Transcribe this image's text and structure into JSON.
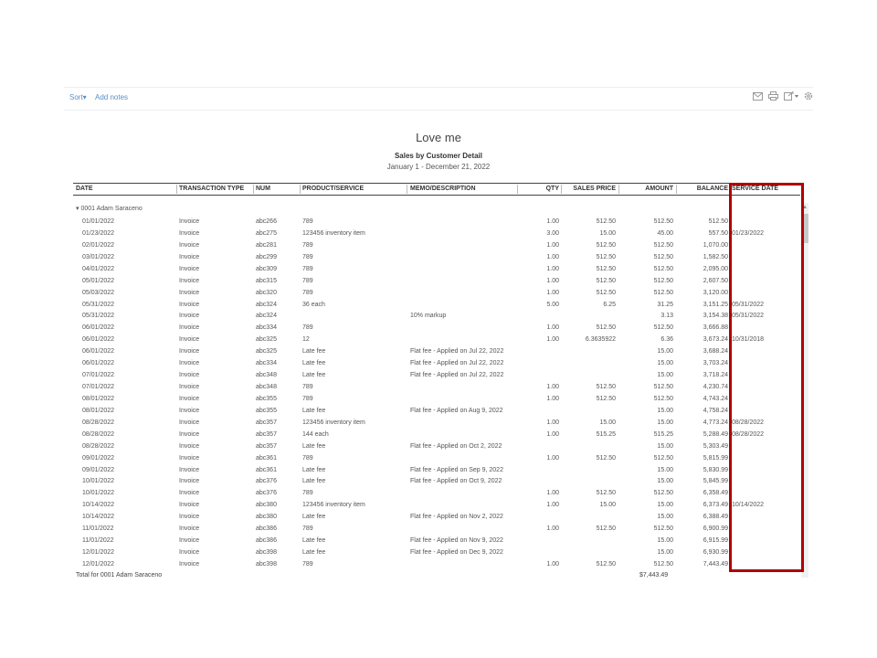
{
  "toolbar": {
    "sort_label": "Sort",
    "sort_caret": "▾",
    "add_notes_label": "Add notes",
    "icons": [
      "email-icon",
      "print-icon",
      "export-icon",
      "settings-icon"
    ]
  },
  "report": {
    "company": "Love me",
    "title": "Sales by Customer Detail",
    "date_range": "January 1 - December 21, 2022"
  },
  "columns": {
    "date": "DATE",
    "type": "TRANSACTION TYPE",
    "num": "NUM",
    "product": "PRODUCT/SERVICE",
    "memo": "MEMO/DESCRIPTION",
    "qty": "QTY",
    "price": "SALES PRICE",
    "amount": "AMOUNT",
    "balance": "BALANCE",
    "service_date": "SERVICE DATE"
  },
  "group": {
    "name": "0001 Adam Saraceno",
    "caret": "▾",
    "total_label": "Total for 0001 Adam Saraceno",
    "total_amount": "$7,443.49"
  },
  "rows": [
    {
      "date": "01/01/2022",
      "type": "Invoice",
      "num": "abc266",
      "product": "789",
      "memo": "",
      "qty": "1.00",
      "price": "512.50",
      "amount": "512.50",
      "balance": "512.50",
      "service_date": ""
    },
    {
      "date": "01/23/2022",
      "type": "Invoice",
      "num": "abc275",
      "product": "123456 inventory item",
      "memo": "",
      "qty": "3.00",
      "price": "15.00",
      "amount": "45.00",
      "balance": "557.50",
      "service_date": "01/23/2022"
    },
    {
      "date": "02/01/2022",
      "type": "Invoice",
      "num": "abc281",
      "product": "789",
      "memo": "",
      "qty": "1.00",
      "price": "512.50",
      "amount": "512.50",
      "balance": "1,070.00",
      "service_date": ""
    },
    {
      "date": "03/01/2022",
      "type": "Invoice",
      "num": "abc299",
      "product": "789",
      "memo": "",
      "qty": "1.00",
      "price": "512.50",
      "amount": "512.50",
      "balance": "1,582.50",
      "service_date": ""
    },
    {
      "date": "04/01/2022",
      "type": "Invoice",
      "num": "abc309",
      "product": "789",
      "memo": "",
      "qty": "1.00",
      "price": "512.50",
      "amount": "512.50",
      "balance": "2,095.00",
      "service_date": ""
    },
    {
      "date": "05/01/2022",
      "type": "Invoice",
      "num": "abc315",
      "product": "789",
      "memo": "",
      "qty": "1.00",
      "price": "512.50",
      "amount": "512.50",
      "balance": "2,607.50",
      "service_date": ""
    },
    {
      "date": "05/03/2022",
      "type": "Invoice",
      "num": "abc320",
      "product": "789",
      "memo": "",
      "qty": "1.00",
      "price": "512.50",
      "amount": "512.50",
      "balance": "3,120.00",
      "service_date": ""
    },
    {
      "date": "05/31/2022",
      "type": "Invoice",
      "num": "abc324",
      "product": "36 each",
      "memo": "",
      "qty": "5.00",
      "price": "6.25",
      "amount": "31.25",
      "balance": "3,151.25",
      "service_date": "05/31/2022"
    },
    {
      "date": "05/31/2022",
      "type": "Invoice",
      "num": "abc324",
      "product": "",
      "memo": "10% markup",
      "qty": "",
      "price": "",
      "amount": "3.13",
      "balance": "3,154.38",
      "service_date": "05/31/2022"
    },
    {
      "date": "06/01/2022",
      "type": "Invoice",
      "num": "abc334",
      "product": "789",
      "memo": "",
      "qty": "1.00",
      "price": "512.50",
      "amount": "512.50",
      "balance": "3,666.88",
      "service_date": ""
    },
    {
      "date": "06/01/2022",
      "type": "Invoice",
      "num": "abc325",
      "product": "12",
      "memo": "",
      "qty": "1.00",
      "price": "6.3635922",
      "amount": "6.36",
      "balance": "3,673.24",
      "service_date": "10/31/2018"
    },
    {
      "date": "06/01/2022",
      "type": "Invoice",
      "num": "abc325",
      "product": "Late fee",
      "memo": "Flat fee - Applied on Jul 22, 2022",
      "qty": "",
      "price": "",
      "amount": "15.00",
      "balance": "3,688.24",
      "service_date": ""
    },
    {
      "date": "06/01/2022",
      "type": "Invoice",
      "num": "abc334",
      "product": "Late fee",
      "memo": "Flat fee - Applied on Jul 22, 2022",
      "qty": "",
      "price": "",
      "amount": "15.00",
      "balance": "3,703.24",
      "service_date": ""
    },
    {
      "date": "07/01/2022",
      "type": "Invoice",
      "num": "abc348",
      "product": "Late fee",
      "memo": "Flat fee - Applied on Jul 22, 2022",
      "qty": "",
      "price": "",
      "amount": "15.00",
      "balance": "3,718.24",
      "service_date": ""
    },
    {
      "date": "07/01/2022",
      "type": "Invoice",
      "num": "abc348",
      "product": "789",
      "memo": "",
      "qty": "1.00",
      "price": "512.50",
      "amount": "512.50",
      "balance": "4,230.74",
      "service_date": ""
    },
    {
      "date": "08/01/2022",
      "type": "Invoice",
      "num": "abc355",
      "product": "789",
      "memo": "",
      "qty": "1.00",
      "price": "512.50",
      "amount": "512.50",
      "balance": "4,743.24",
      "service_date": ""
    },
    {
      "date": "08/01/2022",
      "type": "Invoice",
      "num": "abc355",
      "product": "Late fee",
      "memo": "Flat fee - Applied on Aug 9, 2022",
      "qty": "",
      "price": "",
      "amount": "15.00",
      "balance": "4,758.24",
      "service_date": ""
    },
    {
      "date": "08/28/2022",
      "type": "Invoice",
      "num": "abc357",
      "product": "123456 inventory item",
      "memo": "",
      "qty": "1.00",
      "price": "15.00",
      "amount": "15.00",
      "balance": "4,773.24",
      "service_date": "08/28/2022"
    },
    {
      "date": "08/28/2022",
      "type": "Invoice",
      "num": "abc357",
      "product": "144 each",
      "memo": "",
      "qty": "1.00",
      "price": "515.25",
      "amount": "515.25",
      "balance": "5,288.49",
      "service_date": "08/28/2022"
    },
    {
      "date": "08/28/2022",
      "type": "Invoice",
      "num": "abc357",
      "product": "Late fee",
      "memo": "Flat fee - Applied on Oct 2, 2022",
      "qty": "",
      "price": "",
      "amount": "15.00",
      "balance": "5,303.49",
      "service_date": ""
    },
    {
      "date": "09/01/2022",
      "type": "Invoice",
      "num": "abc361",
      "product": "789",
      "memo": "",
      "qty": "1.00",
      "price": "512.50",
      "amount": "512.50",
      "balance": "5,815.99",
      "service_date": ""
    },
    {
      "date": "09/01/2022",
      "type": "Invoice",
      "num": "abc361",
      "product": "Late fee",
      "memo": "Flat fee - Applied on Sep 9, 2022",
      "qty": "",
      "price": "",
      "amount": "15.00",
      "balance": "5,830.99",
      "service_date": ""
    },
    {
      "date": "10/01/2022",
      "type": "Invoice",
      "num": "abc376",
      "product": "Late fee",
      "memo": "Flat fee - Applied on Oct 9, 2022",
      "qty": "",
      "price": "",
      "amount": "15.00",
      "balance": "5,845.99",
      "service_date": ""
    },
    {
      "date": "10/01/2022",
      "type": "Invoice",
      "num": "abc376",
      "product": "789",
      "memo": "",
      "qty": "1.00",
      "price": "512.50",
      "amount": "512.50",
      "balance": "6,358.49",
      "service_date": ""
    },
    {
      "date": "10/14/2022",
      "type": "Invoice",
      "num": "abc380",
      "product": "123456 inventory item",
      "memo": "",
      "qty": "1.00",
      "price": "15.00",
      "amount": "15.00",
      "balance": "6,373.49",
      "service_date": "10/14/2022"
    },
    {
      "date": "10/14/2022",
      "type": "Invoice",
      "num": "abc380",
      "product": "Late fee",
      "memo": "Flat fee - Applied on Nov 2, 2022",
      "qty": "",
      "price": "",
      "amount": "15.00",
      "balance": "6,388.49",
      "service_date": ""
    },
    {
      "date": "11/01/2022",
      "type": "Invoice",
      "num": "abc386",
      "product": "789",
      "memo": "",
      "qty": "1.00",
      "price": "512.50",
      "amount": "512.50",
      "balance": "6,900.99",
      "service_date": ""
    },
    {
      "date": "11/01/2022",
      "type": "Invoice",
      "num": "abc386",
      "product": "Late fee",
      "memo": "Flat fee - Applied on Nov 9, 2022",
      "qty": "",
      "price": "",
      "amount": "15.00",
      "balance": "6,915.99",
      "service_date": ""
    },
    {
      "date": "12/01/2022",
      "type": "Invoice",
      "num": "abc398",
      "product": "Late fee",
      "memo": "Flat fee - Applied on Dec 9, 2022",
      "qty": "",
      "price": "",
      "amount": "15.00",
      "balance": "6,930.99",
      "service_date": ""
    },
    {
      "date": "12/01/2022",
      "type": "Invoice",
      "num": "abc398",
      "product": "789",
      "memo": "",
      "qty": "1.00",
      "price": "512.50",
      "amount": "512.50",
      "balance": "7,443.49",
      "service_date": ""
    }
  ],
  "highlight": {
    "target": "SERVICE DATE",
    "color": "#b00000"
  },
  "scrollbar": {
    "up_arrow": "▲"
  }
}
